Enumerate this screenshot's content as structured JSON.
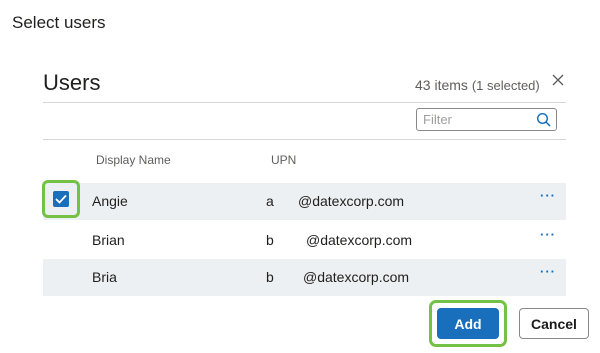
{
  "dialog": {
    "title": "Select users"
  },
  "panel": {
    "title": "Users",
    "item_count": "43 items",
    "selected_count": "(1 selected)"
  },
  "filter": {
    "placeholder": "Filter",
    "value": ""
  },
  "columns": {
    "display_name": "Display Name",
    "upn": "UPN"
  },
  "rows": [
    {
      "display_name": "Angie",
      "upn_prefix": "a",
      "upn_domain": "@datexcorp.com",
      "selected": true,
      "more": "···"
    },
    {
      "display_name": "Brian",
      "upn_prefix": "b",
      "upn_domain": "@datexcorp.com",
      "selected": false,
      "more": "···"
    },
    {
      "display_name": "Bria",
      "upn_prefix": "b",
      "upn_domain": "@datexcorp.com",
      "selected": false,
      "more": "···"
    }
  ],
  "buttons": {
    "add": "Add",
    "cancel": "Cancel"
  },
  "icons": {
    "close": "close-icon",
    "search": "search-icon",
    "checkmark": "checkmark-icon",
    "more": "more-options-icon"
  },
  "colors": {
    "accent": "#1a6fbd",
    "highlight": "#73c246",
    "row_alt": "#edf0f2",
    "link": "#0f6cbd"
  }
}
